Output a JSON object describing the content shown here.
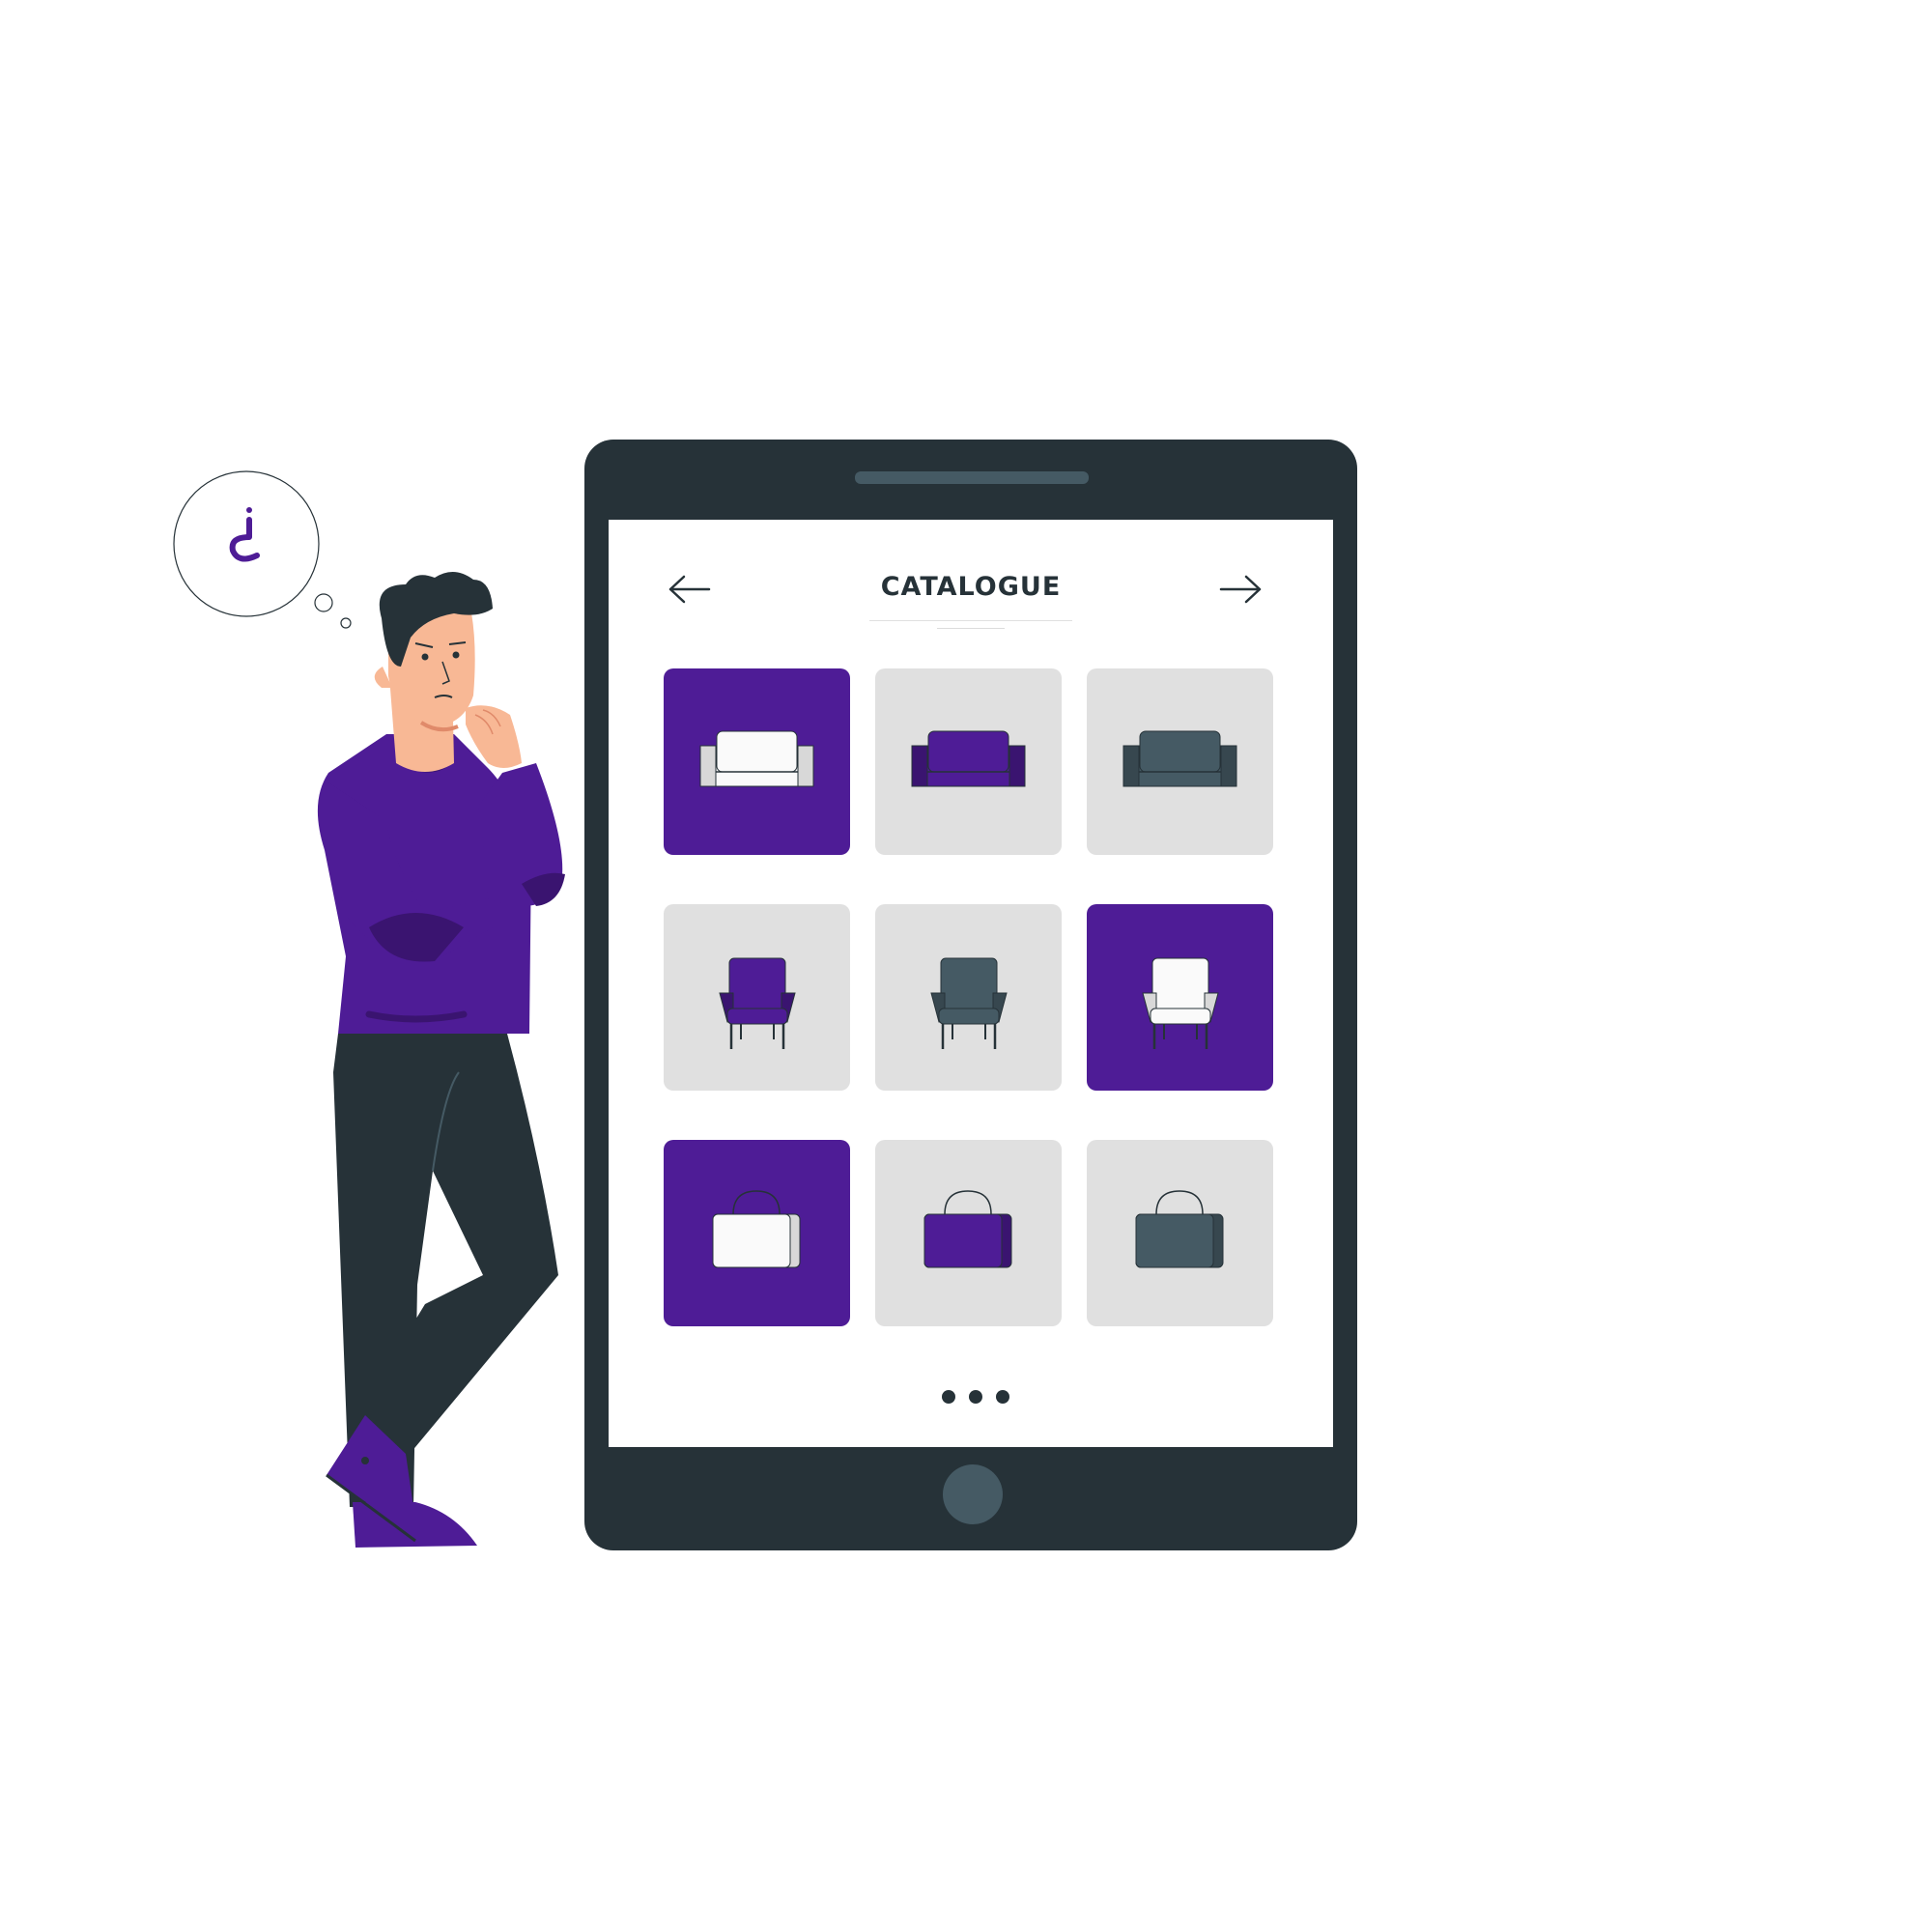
{
  "colors": {
    "purple": "#4e1c96",
    "purple_dark": "#3a1470",
    "tile_gray": "#e0e0e0",
    "slate": "#455a64",
    "device": "#263238",
    "white": "#fafafa"
  },
  "catalogue": {
    "title": "CATALOGUE",
    "prev_icon": "arrow-left-icon",
    "next_icon": "arrow-right-icon",
    "items": [
      {
        "product": "sofa",
        "tile": "purple",
        "item_color": "white"
      },
      {
        "product": "sofa",
        "tile": "gray",
        "item_color": "purple"
      },
      {
        "product": "sofa",
        "tile": "gray",
        "item_color": "slate"
      },
      {
        "product": "armchair",
        "tile": "gray",
        "item_color": "purple"
      },
      {
        "product": "armchair",
        "tile": "gray",
        "item_color": "slate"
      },
      {
        "product": "armchair",
        "tile": "purple",
        "item_color": "white"
      },
      {
        "product": "bag",
        "tile": "purple",
        "item_color": "white"
      },
      {
        "product": "bag",
        "tile": "gray",
        "item_color": "purple"
      },
      {
        "product": "bag",
        "tile": "gray",
        "item_color": "slate"
      }
    ],
    "pager_dots": 3
  },
  "thought_bubble": {
    "icon": "inverted-question-mark-icon"
  }
}
